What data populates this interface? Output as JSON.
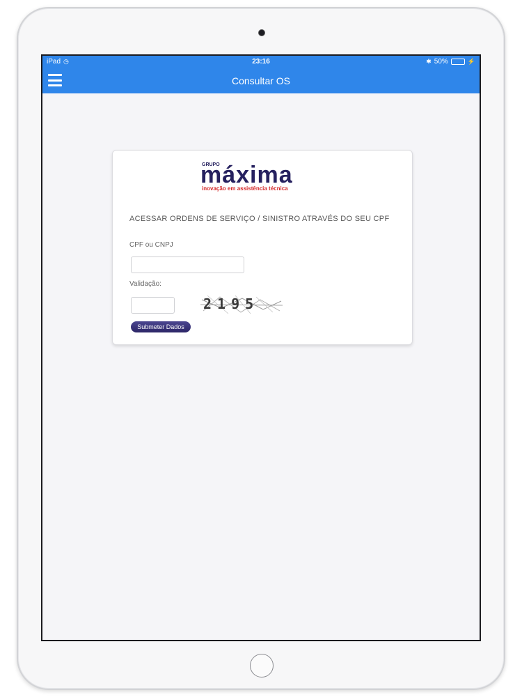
{
  "status_bar": {
    "carrier": "iPad",
    "time": "23:16",
    "battery": "50%"
  },
  "nav": {
    "title": "Consultar OS"
  },
  "logo": {
    "grupo": "GRUPO",
    "name": "máxima",
    "tagline": "inovação em assistência técnica",
    "colors": {
      "primary": "#26215f",
      "accent": "#d52b2b"
    }
  },
  "form": {
    "heading": "ACESSAR ORDENS DE SERVIÇO / SINISTRO ATRAVÉS DO SEU CPF",
    "cpf_label": "CPF ou CNPJ",
    "cpf_value": "",
    "validation_label": "Validação:",
    "validation_value": "",
    "captcha_text": "2195",
    "submit_label": "Submeter Dados"
  },
  "colors": {
    "nav_bg": "#2f86ea",
    "screen_bg": "#f5f5f8"
  }
}
